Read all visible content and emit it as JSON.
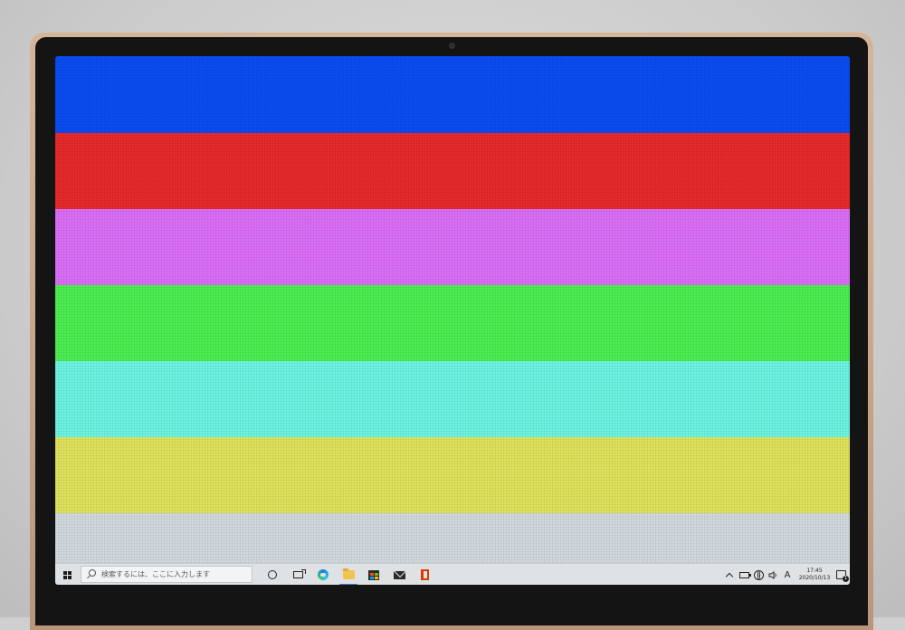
{
  "screen": {
    "stripes": [
      {
        "name": "blue-stripe",
        "color": "#0a4cf3"
      },
      {
        "name": "red-stripe",
        "color": "#e82a2c"
      },
      {
        "name": "magenta-stripe",
        "color": "#db6ef7"
      },
      {
        "name": "green-stripe",
        "color": "#4cef52"
      },
      {
        "name": "cyan-stripe",
        "color": "#6df4e2"
      },
      {
        "name": "yellow-stripe",
        "color": "#dfe35c"
      },
      {
        "name": "gray-stripe",
        "color": "#d2dadf"
      }
    ]
  },
  "taskbar": {
    "start_icon": "windows-logo-icon",
    "search": {
      "placeholder": "検索するには、ここに入力します",
      "icon": "search-icon"
    },
    "pinned": [
      {
        "name": "cortana",
        "icon": "circle-icon"
      },
      {
        "name": "task-view",
        "icon": "task-view-icon"
      },
      {
        "name": "edge",
        "icon": "edge-browser-icon"
      },
      {
        "name": "file-explorer",
        "icon": "folder-icon",
        "active": true
      },
      {
        "name": "microsoft-store",
        "icon": "store-bag-icon"
      },
      {
        "name": "mail",
        "icon": "mail-envelope-icon"
      },
      {
        "name": "office",
        "icon": "office-icon"
      }
    ],
    "tray": {
      "ime_mode": "A",
      "time": "17:45",
      "date": "2020/10/13",
      "notification_count": "1"
    }
  }
}
